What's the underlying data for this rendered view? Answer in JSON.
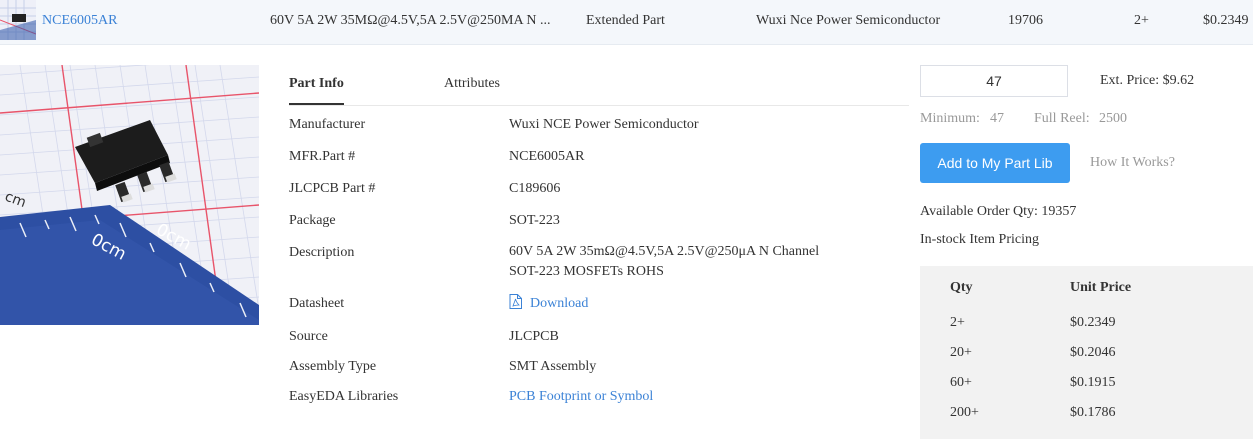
{
  "top_row": {
    "part_number": "NCE6005AR",
    "description": "60V 5A 2W 35MΩ@4.5V,5A 2.5V@250MA N ...",
    "part_type": "Extended Part",
    "manufacturer": "Wuxi Nce Power Semiconductor",
    "stock": "19706",
    "min_qty": "2+",
    "price": "$0.2349"
  },
  "tabs": [
    {
      "label": "Part Info",
      "active": true
    },
    {
      "label": "Attributes",
      "active": false
    }
  ],
  "part_info": {
    "manufacturer_label": "Manufacturer",
    "manufacturer_value": "Wuxi NCE Power Semiconductor",
    "mfr_part_label": "MFR.Part #",
    "mfr_part_value": "NCE6005AR",
    "jlcpcb_part_label": "JLCPCB Part #",
    "jlcpcb_part_value": "C189606",
    "package_label": "Package",
    "package_value": "SOT-223",
    "description_label": "Description",
    "description_line1": "60V 5A 2W 35mΩ@4.5V,5A 2.5V@250μA N Channel",
    "description_line2": "SOT-223 MOSFETs ROHS",
    "datasheet_label": "Datasheet",
    "datasheet_link": "Download",
    "source_label": "Source",
    "source_value": "JLCPCB",
    "assembly_label": "Assembly Type",
    "assembly_value": "SMT Assembly",
    "easyeda_label": "EasyEDA Libraries",
    "easyeda_link": "PCB Footprint or Symbol"
  },
  "order": {
    "quantity": "47",
    "ext_price": "Ext. Price: $9.62",
    "minimum_label": "Minimum:",
    "minimum_value": "47",
    "full_reel_label": "Full Reel:",
    "full_reel_value": "2500",
    "add_button": "Add to My Part Lib",
    "how_it_works": "How It Works?",
    "available_qty": "Available Order Qty: 19357",
    "instock_pricing": "In-stock Item Pricing"
  },
  "price_table": {
    "headers": [
      "Qty",
      "Unit Price"
    ],
    "rows": [
      [
        "2+",
        "$0.2349"
      ],
      [
        "20+",
        "$0.2046"
      ],
      [
        "60+",
        "$0.1915"
      ],
      [
        "200+",
        "$0.1786"
      ]
    ]
  },
  "image_text": {
    "ruler_labels": [
      "cm",
      "0cm",
      "0cm"
    ]
  },
  "colors": {
    "link": "#3b82d6",
    "primary_button": "#3d9cf0",
    "top_row_bg": "#f4f7fb",
    "price_table_bg": "#f2f2f2",
    "grid_red": "#e8546a",
    "grid_blue": "#b9c3e3"
  },
  "icons": {
    "datasheet": "pdf-file-icon"
  }
}
